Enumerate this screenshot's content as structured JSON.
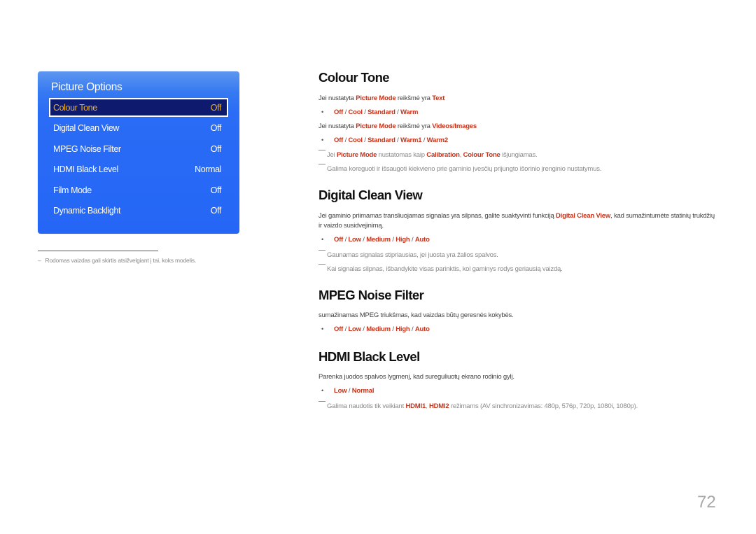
{
  "panel": {
    "title": "Picture Options",
    "items": [
      {
        "label": "Colour Tone",
        "value": "Off",
        "selected": true
      },
      {
        "label": "Digital Clean View",
        "value": "Off"
      },
      {
        "label": "MPEG Noise Filter",
        "value": "Off"
      },
      {
        "label": "HDMI Black Level",
        "value": "Normal"
      },
      {
        "label": "Film Mode",
        "value": "Off"
      },
      {
        "label": "Dynamic Backlight",
        "value": "Off"
      }
    ],
    "colors": {
      "background": "#2566f6",
      "selected_bg": "#0d1a6e",
      "selected_text": "#f2b21c"
    }
  },
  "footnote": {
    "dash": "–",
    "text": "Rodomas vaizdas gali skirtis atsižvelgiant į tai, koks modelis."
  },
  "sections": {
    "colour_tone": {
      "title": "Colour Tone",
      "line1": {
        "pre": "Jei nustatyta ",
        "k1": "Picture Mode",
        "mid": " reikšmė yra ",
        "k2": "Text"
      },
      "options1": [
        "Off",
        "Cool",
        "Standard",
        "Warm"
      ],
      "line2": {
        "pre": "Jei nustatyta ",
        "k1": "Picture Mode",
        "mid": " reikšmė yra ",
        "k2": "Videos/Images"
      },
      "options2": [
        "Off",
        "Cool",
        "Standard",
        "Warm1",
        "Warm2"
      ],
      "note1": {
        "pre": "Jei ",
        "k1": "Picture Mode",
        "mid": " nustatomas kaip ",
        "k2": "Calibration",
        "sep": ", ",
        "k3": "Colour Tone",
        "post": " išjungiamas."
      },
      "note2": "Galima koreguoti ir išsaugoti kiekvieno prie gaminio įvesčių prijungto išorinio įrenginio nustatymus."
    },
    "digital_clean_view": {
      "title": "Digital Clean View",
      "desc": {
        "pre": "Jei gaminio priimamas transliuojamas signalas yra silpnas, galite suaktyvinti funkciją ",
        "k1": "Digital Clean View",
        "post": ", kad sumažintumėte statinių trukdžių ir vaizdo susidvejinimą."
      },
      "options": [
        "Off",
        "Low",
        "Medium",
        "High",
        "Auto"
      ],
      "note1": "Gaunamas signalas stipriausias, jei juosta yra žalios spalvos.",
      "note2": "Kai signalas silpnas, išbandykite visas parinktis, kol gaminys rodys geriausią vaizdą."
    },
    "mpeg_noise_filter": {
      "title": "MPEG Noise Filter",
      "desc": "sumažinamas MPEG triukšmas, kad vaizdas būtų geresnės kokybės.",
      "options": [
        "Off",
        "Low",
        "Medium",
        "High",
        "Auto"
      ]
    },
    "hdmi_black_level": {
      "title": "HDMI Black Level",
      "desc": "Parenka juodos spalvos lygmenį, kad sureguliuotų ekrano rodinio gylį.",
      "options": [
        "Low",
        "Normal"
      ],
      "note": {
        "pre": "Galima naudotis tik veikiant ",
        "k1": "HDMI1",
        "sep": ", ",
        "k2": "HDMI2",
        "post": " režimams (AV sinchronizavimas: 480p, 576p, 720p, 1080i, 1080p)."
      }
    }
  },
  "accent_color": "#c7321a",
  "page_number": "72"
}
